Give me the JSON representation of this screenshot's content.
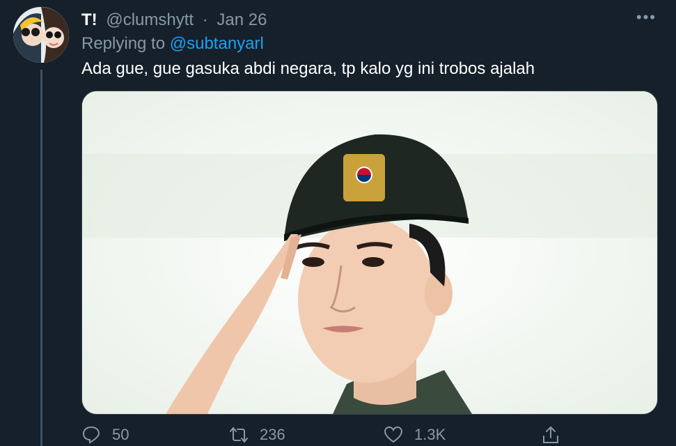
{
  "tweet": {
    "display_name": "T!",
    "handle": "@clumshytt",
    "separator": "·",
    "date": "Jan 26",
    "more_label": "•••",
    "reply_prefix": "Replying to",
    "reply_to": "@subtanyarl",
    "text": "Ada gue, gue gasuka abdi negara, tp kalo yg ini trobos ajalah"
  },
  "actions": {
    "reply_count": "50",
    "retweet_count": "236",
    "like_count": "1.3K",
    "share_icon": "share-icon",
    "reply_icon": "reply-icon",
    "retweet_icon": "retweet-icon",
    "like_icon": "heart-icon"
  },
  "colors": {
    "background": "#15202b",
    "secondary_text": "#8899a6",
    "accent": "#1da1f2",
    "border": "#38444d"
  }
}
